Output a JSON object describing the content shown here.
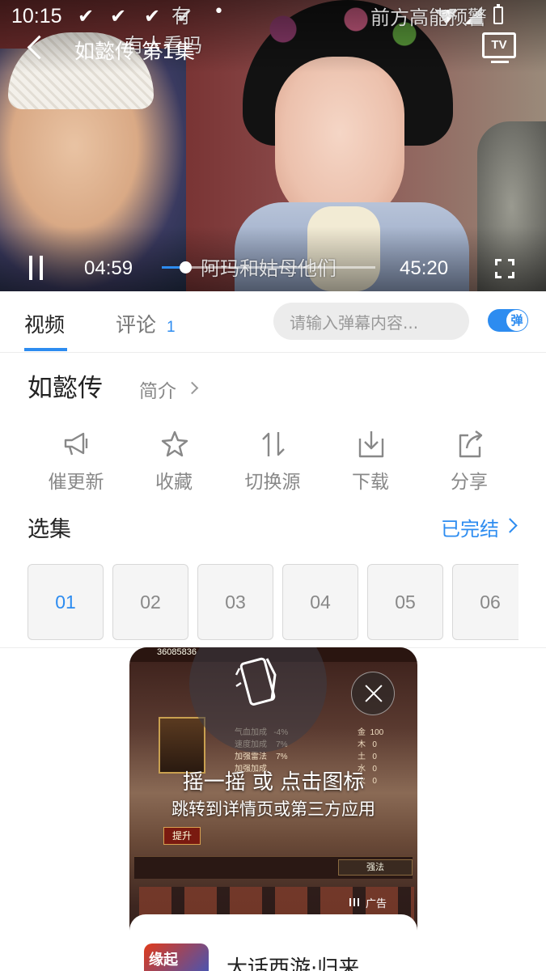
{
  "statusbar": {
    "time": "10:15",
    "check_marks": [
      "✔",
      "✔",
      "✔",
      "✔"
    ],
    "dot": "•"
  },
  "player": {
    "title": "如懿传 第1集",
    "current_time": "04:59",
    "total_time": "45:20",
    "progress_fraction": 0.11,
    "tv_label": "TV",
    "danmaku": [
      {
        "text": "有",
        "id": "d1"
      },
      {
        "text": "有人看吗",
        "id": "d2"
      },
      {
        "text": "前方高能预警",
        "id": "d3"
      },
      {
        "text": "阿玛和姑母他们",
        "id": "d4"
      }
    ]
  },
  "tabs": {
    "video_label": "视频",
    "comment_label": "评论",
    "comment_count": "1",
    "danmu_placeholder": "请输入弹幕内容...",
    "danmu_toggle_label": "弹"
  },
  "show": {
    "title": "如懿传",
    "intro_label": "简介"
  },
  "actions": [
    {
      "label": "催更新",
      "icon": "megaphone-icon"
    },
    {
      "label": "收藏",
      "icon": "star-icon"
    },
    {
      "label": "切换源",
      "icon": "switch-source-icon"
    },
    {
      "label": "下载",
      "icon": "download-icon"
    },
    {
      "label": "分享",
      "icon": "share-icon"
    }
  ],
  "episodes": {
    "label": "选集",
    "status_label": "已完结",
    "items": [
      "01",
      "02",
      "03",
      "04",
      "05",
      "06"
    ],
    "selected": "01"
  },
  "ad": {
    "headline": "摇一摇 或 点击图标",
    "subline": "跳转到详情页或第三方应用",
    "tag": "广告",
    "app_name": "大话西游·归来",
    "app_icon_text": "缘起",
    "game_topbar": "36085836",
    "game_stats_left": "气血加成   -4%\n速度加成    7%\n加强雷法    7%\n加强加成\n",
    "game_stats_right": "金  100\n木   0\n土   0\n水   0\n火   0",
    "game_upgrade": "提升",
    "game_filter": "强法",
    "colors": {
      "accent": "#2d8cf0"
    }
  }
}
